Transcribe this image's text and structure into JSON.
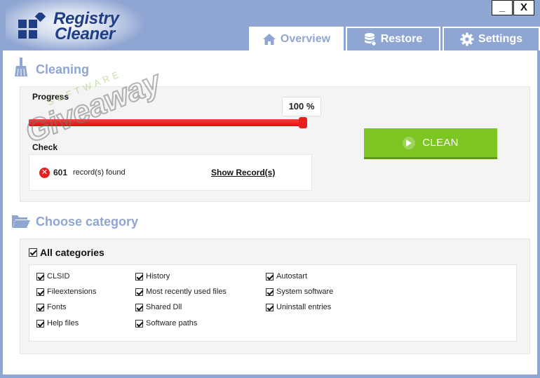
{
  "app": {
    "logo_line1": "Registry",
    "logo_line2": "Cleaner"
  },
  "window": {
    "minimize": "_",
    "close": "X"
  },
  "tabs": [
    {
      "label": "Overview",
      "icon": "home-icon",
      "active": true
    },
    {
      "label": "Restore",
      "icon": "database-icon",
      "active": false
    },
    {
      "label": "Settings",
      "icon": "gear-icon",
      "active": false
    }
  ],
  "cleaning": {
    "title": "Cleaning",
    "progress_label": "Progress",
    "progress_percent": 100,
    "progress_text": "100 %",
    "check_label": "Check",
    "records_count": "601",
    "records_text": "record(s) found",
    "show_records": "Show Record(s)",
    "clean_button": "CLEAN"
  },
  "category": {
    "title": "Choose category",
    "all_label": "All categories",
    "all_checked": true,
    "items": [
      {
        "label": "CLSID",
        "checked": true
      },
      {
        "label": "Fileextensions",
        "checked": true
      },
      {
        "label": "Fonts",
        "checked": true
      },
      {
        "label": "Help files",
        "checked": true
      },
      {
        "label": "History",
        "checked": true
      },
      {
        "label": "Most recently used files",
        "checked": true
      },
      {
        "label": "Shared Dll",
        "checked": true
      },
      {
        "label": "Software paths",
        "checked": true
      },
      {
        "label": "Autostart",
        "checked": true
      },
      {
        "label": "System software",
        "checked": true
      },
      {
        "label": "Uninstall entries",
        "checked": true
      }
    ]
  },
  "watermark": {
    "main": "Giveaway",
    "sub": "SOFTWARE"
  },
  "colors": {
    "frame": "#8fa6d3",
    "logo": "#1f3e86",
    "progress": "#e81e1e",
    "clean_button": "#7dc522",
    "error": "#e32020"
  }
}
